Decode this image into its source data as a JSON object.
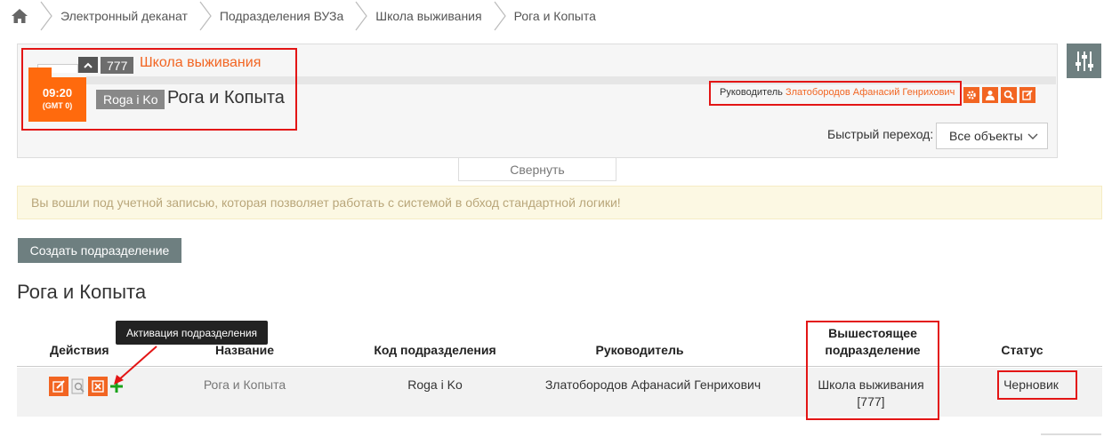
{
  "breadcrumb": {
    "items": [
      "Электронный деканат",
      "Подразделения ВУЗа",
      "Школа выживания",
      "Рога и Копыта"
    ]
  },
  "header": {
    "time": "09:20",
    "gmt": "(GMT 0)",
    "parent_code": "777",
    "parent_name": "Школа выживания",
    "unit_code": "Roga i Ko",
    "unit_name": "Рога и Копыта",
    "leader_label": "Руководитель",
    "leader_name": "Златобородов Афанасий Генрихович",
    "quick_nav_label": "Быстрый переход:",
    "quick_nav_value": "Все объекты",
    "collapse_label": "Свернуть"
  },
  "alert": {
    "text": "Вы вошли под учетной записью, которая позволяет работать с системой в обход стандартной логики!"
  },
  "create_button": "Создать подразделение",
  "section_title": "Рога и Копыта",
  "tooltip": "Активация подразделения",
  "table": {
    "headers": {
      "actions": "Действия",
      "name": "Название",
      "code": "Код подразделения",
      "leader": "Руководитель",
      "parent_line1": "Вышестоящее",
      "parent_line2": "подразделение",
      "status": "Статус"
    },
    "rows": [
      {
        "name": "Рога и Копыта",
        "code": "Roga i Ko",
        "leader": "Златобородов Афанасий Генрихович",
        "parent_line1": "Школа выживания",
        "parent_line2": "[777]",
        "status": "Черновик"
      }
    ]
  },
  "colors": {
    "accent": "#f26522",
    "highlight": "#e31515",
    "button_gray": "#6e7f80",
    "alert_bg": "#fcf8e3"
  },
  "icons": [
    "home-icon",
    "settings-sliders-icon",
    "gear-icon",
    "user-icon",
    "search-icon",
    "edit-icon",
    "chevron-up-icon",
    "chevron-down-icon",
    "document-preview-icon",
    "delete-icon",
    "plus-icon"
  ]
}
